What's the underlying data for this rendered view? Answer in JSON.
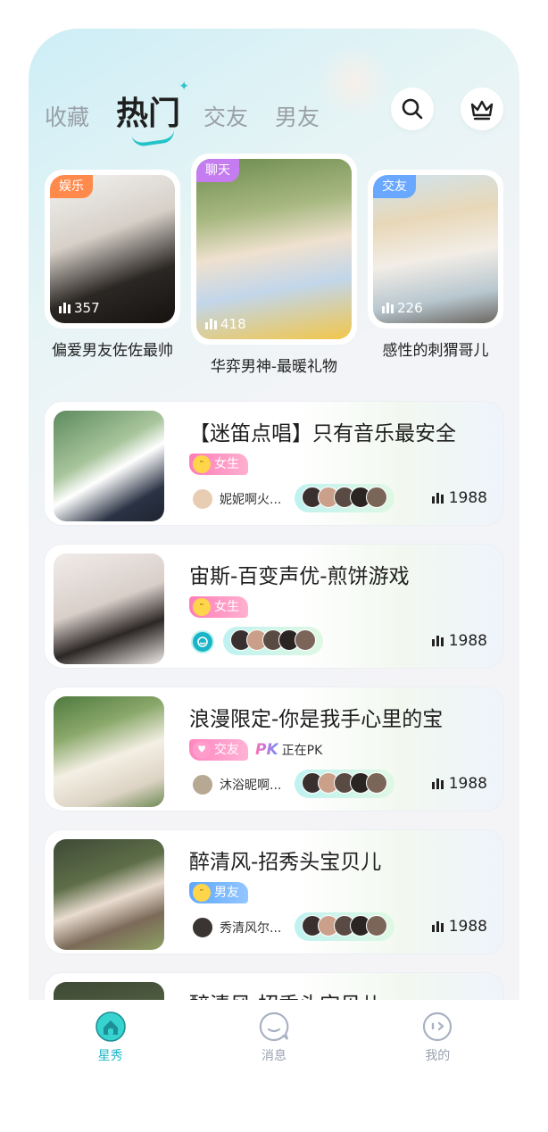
{
  "header": {
    "tabs": [
      {
        "label": "收藏",
        "active": false
      },
      {
        "label": "热门",
        "active": true
      },
      {
        "label": "交友",
        "active": false
      },
      {
        "label": "男友",
        "active": false
      }
    ],
    "icons": [
      "search-icon",
      "crown-icon"
    ]
  },
  "featured": [
    {
      "badge": "娱乐",
      "badge_color": "#ff8a4c",
      "views": "357",
      "caption": "偏爱男友佐佐最帅"
    },
    {
      "badge": "聊天",
      "badge_color": "#c47cf0",
      "views": "418",
      "caption": "华弈男神-最暖礼物"
    },
    {
      "badge": "交友",
      "badge_color": "#6aa8ff",
      "views": "226",
      "caption": "感性的刺猬哥儿"
    }
  ],
  "rooms": [
    {
      "title": "【迷笛点唱】只有音乐最安全",
      "tag": "女生",
      "pk": false,
      "host": "妮妮啊火...",
      "count": "1988"
    },
    {
      "title": "宙斯-百变声优-煎饼游戏",
      "tag": "女生",
      "pk": false,
      "host": "",
      "count": "1988"
    },
    {
      "title": "浪漫限定-你是我手心里的宝",
      "tag": "交友",
      "pk": true,
      "pk_logo": "PK",
      "pk_text": "正在PK",
      "host": "沐浴昵啊...",
      "count": "1988"
    },
    {
      "title": "醉清风-招秀头宝贝儿",
      "tag": "男友",
      "pk": false,
      "host": "秀清风尔...",
      "count": "1988"
    },
    {
      "title": "醉清风-招秀头宝贝儿",
      "tag": "",
      "pk": false,
      "host": "",
      "count": ""
    }
  ],
  "nav": [
    {
      "label": "星秀",
      "icon": "home-icon",
      "active": true
    },
    {
      "label": "消息",
      "icon": "message-icon",
      "active": false
    },
    {
      "label": "我的",
      "icon": "profile-icon",
      "active": false
    }
  ],
  "colors": {
    "accent": "#1fb6c6",
    "girl_tag": "#ff7db8",
    "boy_tag": "#5fa8ff"
  }
}
